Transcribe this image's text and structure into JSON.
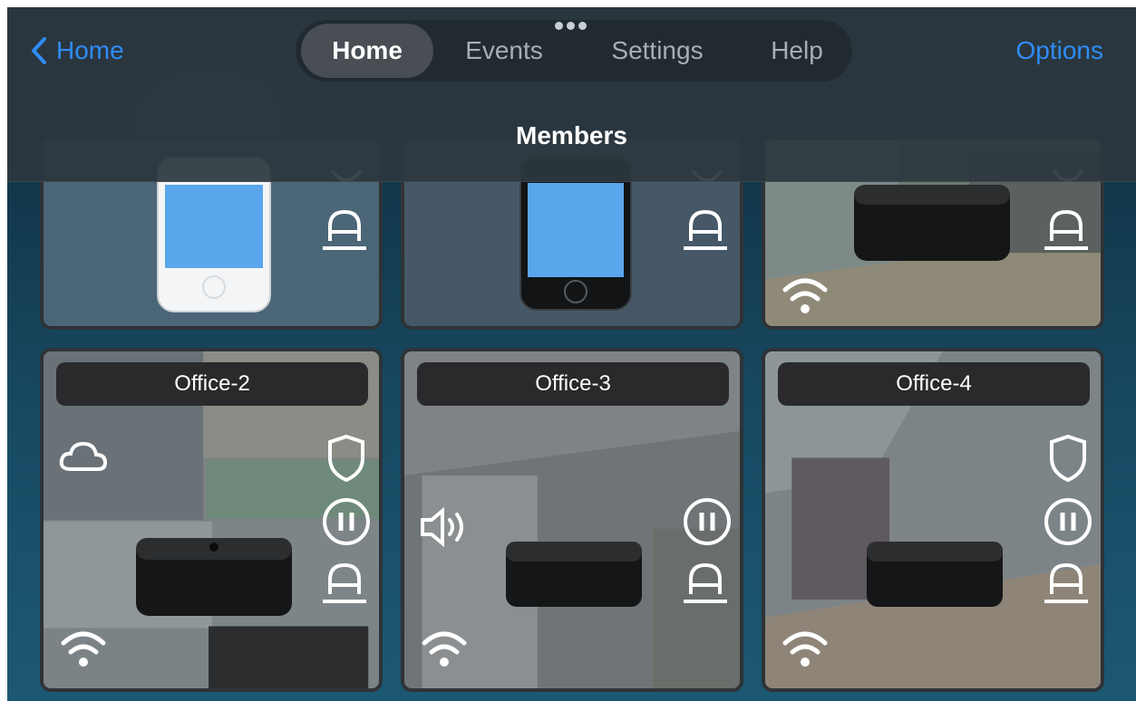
{
  "nav": {
    "back_label": "Home",
    "tabs": [
      {
        "label": "Home",
        "active": true
      },
      {
        "label": "Events",
        "active": false
      },
      {
        "label": "Settings",
        "active": false
      },
      {
        "label": "Help",
        "active": false
      }
    ],
    "options_label": "Options",
    "title": "Members"
  },
  "colors": {
    "accent": "#2f8cf7",
    "header_bg": "#2c373e",
    "label_bg": "#2a2a2c"
  },
  "members": [
    {
      "device": "iPod touch (white)",
      "label": "",
      "icons": [
        "bell-icon"
      ]
    },
    {
      "device": "iPhone (black)",
      "label": "",
      "icons": [
        "bell-icon"
      ]
    },
    {
      "device": "Apple TV",
      "label": "",
      "icons": [
        "bell-icon",
        "wifi-icon"
      ]
    },
    {
      "device": "Apple TV",
      "label": "Office-2",
      "icons": [
        "cloud-icon",
        "shield-icon",
        "pause-icon",
        "bell-icon",
        "wifi-icon"
      ]
    },
    {
      "device": "Apple TV",
      "label": "Office-3",
      "icons": [
        "speaker-icon",
        "pause-icon",
        "bell-icon",
        "wifi-icon"
      ]
    },
    {
      "device": "Apple TV",
      "label": "Office-4",
      "icons": [
        "shield-icon",
        "pause-icon",
        "bell-icon",
        "wifi-icon"
      ]
    }
  ]
}
